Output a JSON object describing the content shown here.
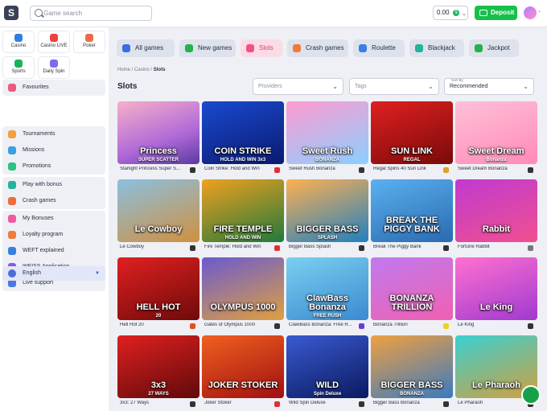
{
  "header": {
    "logo": "S",
    "search_placeholder": "Game search",
    "balance": "0.00",
    "deposit_label": "Deposit"
  },
  "sidebar": {
    "quick": [
      {
        "label": "Casino",
        "color": "#2f7fe0"
      },
      {
        "label": "Casino LIVE",
        "color": "#f04040"
      },
      {
        "label": "Poker",
        "color": "#f26a4a"
      },
      {
        "label": "Sports",
        "color": "#19b25a"
      },
      {
        "label": "Daily Spin",
        "color": "#7a6cf0"
      }
    ],
    "items": [
      {
        "label": "Favourites",
        "color": "#f05a7a"
      },
      {
        "label": "Tournaments",
        "color": "#f2a03a"
      },
      {
        "label": "Missions",
        "color": "#3aa0e0"
      },
      {
        "label": "Promotions",
        "color": "#2ec27e"
      },
      {
        "label": "Play with bonus",
        "color": "#24b29a"
      },
      {
        "label": "Crash games",
        "color": "#f26a3a"
      },
      {
        "label": "My Bonuses",
        "color": "#f05aa0"
      },
      {
        "label": "Loyalty program",
        "color": "#f27a3a"
      },
      {
        "label": "WEFT explained",
        "color": "#3a80e0"
      },
      {
        "label": "WEISS Application",
        "color": "#8a5ae0"
      },
      {
        "label": "Live support",
        "color": "#4a7ae0"
      }
    ],
    "language": "English"
  },
  "categories": [
    {
      "label": "All games",
      "color": "#3a6ee0"
    },
    {
      "label": "New games",
      "color": "#24b24a"
    },
    {
      "label": "Slots",
      "color": "#f0508a",
      "active": true
    },
    {
      "label": "Crash games",
      "color": "#f07a3a"
    },
    {
      "label": "Roulette",
      "color": "#3a80e0"
    },
    {
      "label": "Blackjack",
      "color": "#24b29a"
    },
    {
      "label": "Jackpot",
      "color": "#24b24a"
    }
  ],
  "breadcrumb": {
    "home": "Home",
    "casino": "Casino",
    "current": "Slots"
  },
  "page_title": "Slots",
  "filters": {
    "providers": "Providers",
    "tags": "Tags",
    "sort_label": "Sort By",
    "sort_value": "Recommended"
  },
  "games": [
    {
      "name": "Starlight Princess Super S...",
      "art": "Princess",
      "sub": "SUPER SCATTER",
      "bg": "linear-gradient(160deg,#f7b0c8,#b06ad8 60%,#5a3aa0)",
      "prov": "#333"
    },
    {
      "name": "Coin Strike: Hold and Win",
      "art": "COIN STRIKE",
      "sub": "HOLD AND WIN 3x3",
      "bg": "linear-gradient(160deg,#1a4ad0,#0a1a70)",
      "prov": "#e03030"
    },
    {
      "name": "Sweet Rush Bonanza",
      "art": "Sweet Rush",
      "sub": "BONANZA",
      "bg": "linear-gradient(160deg,#ff9ad0,#8ad0ff)",
      "prov": "#333"
    },
    {
      "name": "Regal Spins 40 Sun Link",
      "art": "SUN LINK",
      "sub": "REGAL",
      "bg": "linear-gradient(160deg,#e02020,#7a0a0a)",
      "prov": "#e0a020"
    },
    {
      "name": "Sweet Dream Bonanza",
      "art": "Sweet Dream",
      "sub": "Bonanza",
      "bg": "linear-gradient(160deg,#ffc0d8,#ff8ab8)",
      "prov": "#333"
    },
    {
      "name": "Le Cowboy",
      "art": "Le Cowboy",
      "sub": "",
      "bg": "linear-gradient(160deg,#8ac0e0,#d09040)",
      "prov": "#333"
    },
    {
      "name": "Fire Temple: Hold and Win",
      "art": "FIRE TEMPLE",
      "sub": "HOLD AND WIN",
      "bg": "linear-gradient(160deg,#f0a020,#207a3a)",
      "prov": "#e03030"
    },
    {
      "name": "Bigger Bass Splash",
      "art": "BIGGER BASS",
      "sub": "SPLASH",
      "bg": "linear-gradient(160deg,#ffb050,#2080c0)",
      "prov": "#333"
    },
    {
      "name": "Break The Piggy Bank",
      "art": "BREAK THE PIGGY BANK",
      "sub": "",
      "bg": "linear-gradient(160deg,#5ab0f0,#2a6ab0)",
      "prov": "#333"
    },
    {
      "name": "Fortune Rabbit",
      "art": "Rabbit",
      "sub": "",
      "bg": "linear-gradient(160deg,#c03ad0,#f05090)",
      "prov": "#777"
    },
    {
      "name": "Hell Hot 20",
      "art": "HELL HOT",
      "sub": "20",
      "bg": "linear-gradient(160deg,#e02020,#700a0a)",
      "prov": "#e05020"
    },
    {
      "name": "Gates of Olympus 1000",
      "art": "OLYMPUS 1000",
      "sub": "",
      "bg": "linear-gradient(160deg,#6a5ad0,#e0a040)",
      "prov": "#333"
    },
    {
      "name": "ClawBass Bonanza: Free R...",
      "art": "ClawBass Bonanza",
      "sub": "FREE RUSH",
      "bg": "linear-gradient(160deg,#7ad0f0,#3a8ad0)",
      "prov": "#6a3ae0"
    },
    {
      "name": "Bonanza Trillion",
      "art": "BONANZA TRILLION",
      "sub": "",
      "bg": "linear-gradient(160deg,#c07af0,#f060b0)",
      "prov": "#f0d020"
    },
    {
      "name": "Le King",
      "art": "Le King",
      "sub": "",
      "bg": "linear-gradient(160deg,#ff70d0,#a03ad0)",
      "prov": "#333"
    },
    {
      "name": "3x3: 27 Ways",
      "art": "3x3",
      "sub": "27 WAYS",
      "bg": "linear-gradient(160deg,#e02020,#600a0a)",
      "prov": "#333"
    },
    {
      "name": "Joker Stoker",
      "art": "JOKER STOKER",
      "sub": "",
      "bg": "linear-gradient(160deg,#f06020,#a01010)",
      "prov": "#e03030"
    },
    {
      "name": "Wild Spin Deluxe",
      "art": "WILD",
      "sub": "Spin Deluxe",
      "bg": "linear-gradient(160deg,#3a5ad0,#0a1a60)",
      "prov": "#333"
    },
    {
      "name": "Bigger Bass Bonanza",
      "art": "BIGGER BASS",
      "sub": "BONANZA",
      "bg": "linear-gradient(160deg,#f0a040,#3a7ac0)",
      "prov": "#333"
    },
    {
      "name": "Le Pharaoh",
      "art": "Le Pharaoh",
      "sub": "",
      "bg": "linear-gradient(160deg,#3ad0d0,#d0a040)",
      "prov": "#333"
    }
  ]
}
